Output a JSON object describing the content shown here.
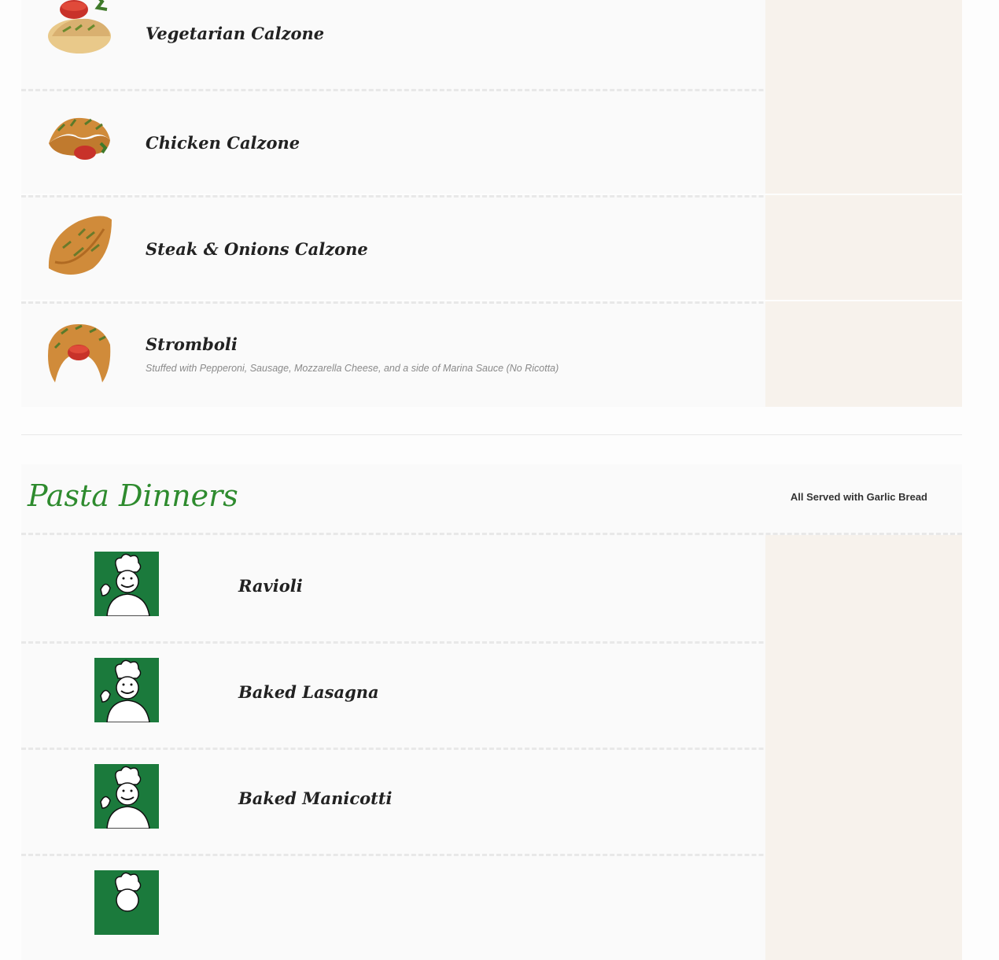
{
  "calzone_items": [
    {
      "name": "Vegetarian Calzone",
      "image": "calzone-with-sauce-photo"
    },
    {
      "name": "Chicken Calzone",
      "image": "calzone-photo"
    },
    {
      "name": "Steak & Onions Calzone",
      "image": "calzone-photo"
    },
    {
      "name": "Stromboli",
      "description": "Stuffed with Pepperoni, Sausage, Mozzarella Cheese, and a side of Marina Sauce (No Ricotta)",
      "image": "stromboli-photo"
    }
  ],
  "pasta_section": {
    "title": "Pasta Dinners",
    "note": "All Served with Garlic Bread",
    "title_color": "#2e8b2e"
  },
  "pasta_items": [
    {
      "name": "Ravioli",
      "image": "chef-logo"
    },
    {
      "name": "Baked Lasagna",
      "image": "chef-logo"
    },
    {
      "name": "Baked Manicotti",
      "image": "chef-logo"
    },
    {
      "name": "",
      "image": "chef-logo"
    }
  ],
  "colors": {
    "price_column": "#f7f2ec",
    "row_bg": "#fafafa",
    "chef_bg": "#1b7a3c"
  }
}
